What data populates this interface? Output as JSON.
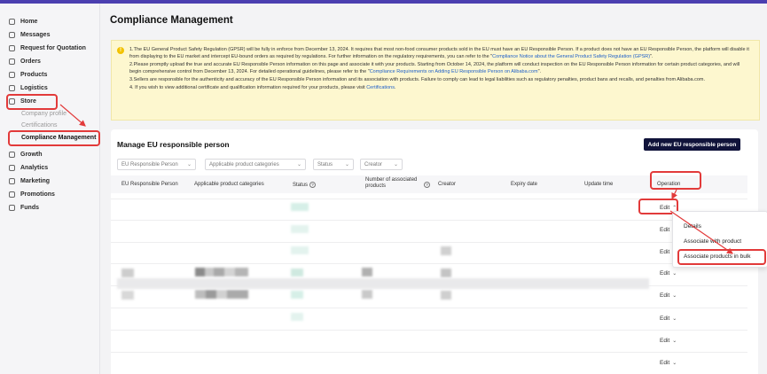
{
  "sidebar": {
    "items": [
      {
        "label": "Home",
        "icon": "home-icon"
      },
      {
        "label": "Messages",
        "icon": "message-icon"
      },
      {
        "label": "Request for Quotation",
        "icon": "rfq-icon"
      },
      {
        "label": "Orders",
        "icon": "orders-icon"
      },
      {
        "label": "Products",
        "icon": "products-icon"
      },
      {
        "label": "Logistics",
        "icon": "truck-icon"
      },
      {
        "label": "Store",
        "icon": "store-icon"
      },
      {
        "label": "Growth",
        "icon": "growth-icon"
      },
      {
        "label": "Analytics",
        "icon": "chart-icon"
      },
      {
        "label": "Marketing",
        "icon": "megaphone-icon"
      },
      {
        "label": "Promotions",
        "icon": "tag-icon"
      },
      {
        "label": "Funds",
        "icon": "wallet-icon"
      }
    ],
    "store_sub": [
      "Company profile",
      "Certifications",
      "Compliance Management"
    ]
  },
  "page": {
    "title": "Compliance Management"
  },
  "notice": {
    "p1_a": "1.The EU General Product Safety Regulation (GPSR) will be fully in enforce from December 13, 2024. It requires that most non-food consumer products sold in the EU must have an EU Responsible Person. If a product does not have an EU Responsible Person, the platform will disable it from displaying to the EU market and intercept EU-bound orders as required by regulations. For further information on the regulatory requirements, you can refer to the \"",
    "p1_link": "Compliance Notice about the General Product Safety Regulation (GPSR)",
    "p1_b": "\".",
    "p2_a": "2.Please promptly upload the true and accurate EU Responsible Person information on this page and associate it with your products. Starting from October 14, 2024, the platform will conduct inspection on the EU Responsible Person information for certain product categories, and will begin comprehensive control from December 13, 2024. For detailed operational guidelines, please refer to the \"",
    "p2_link": "Compliance Requirements on Adding EU Responsible Person on Alibaba.com",
    "p2_b": "\".",
    "p3": "3.Sellers are responsible for the authenticity and accuracy of the EU Responsible Person information and its association with products. Failure to comply can lead to legal liabilities such as regulatory penalties, product bans and recalls, and penalties from Alibaba.com.",
    "p4_a": "4. If you wish to view additional certificate and qualification information required for your products, please visit ",
    "p4_link": "Certifications",
    "p4_b": "."
  },
  "manage": {
    "title": "Manage EU responsible person",
    "add_button": "Add new EU responsible person",
    "filters": [
      "EU Responsible Person",
      "Applicable product categories",
      "Status",
      "Creator"
    ],
    "columns": [
      "EU Responsible Person",
      "Applicable product categories",
      "Status",
      "Number of associated products",
      "Creator",
      "Expiry date",
      "Update time",
      "Operation"
    ],
    "edit_label": "Edit"
  },
  "dropdown": {
    "items": [
      "Details",
      "Associate with product",
      "Associate products in bulk"
    ]
  },
  "colors": {
    "accent": "#4b3fb0",
    "highlight": "#e23a3a",
    "button": "#10133a",
    "notice_bg": "#fdf7cf",
    "link": "#1d5fc9"
  }
}
